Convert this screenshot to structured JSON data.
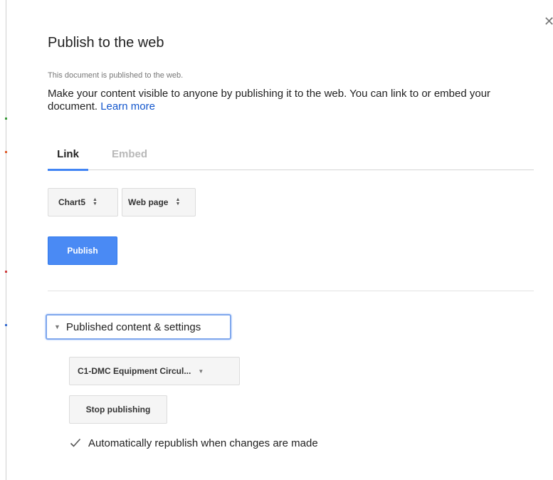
{
  "dialog": {
    "title": "Publish to the web",
    "status_note": "This document is published to the web.",
    "description": "Make your content visible to anyone by publishing it to the web. You can link to or embed your document.",
    "learn_more": "Learn more"
  },
  "tabs": [
    {
      "label": "Link",
      "selected": true
    },
    {
      "label": "Embed",
      "selected": false
    }
  ],
  "selectors": {
    "sheet": "Chart5",
    "format": "Web page"
  },
  "publish_label": "Publish",
  "settings": {
    "toggle_label": "Published content & settings",
    "expanded": true,
    "document_select": "C1-DMC Equipment Circul...",
    "stop_label": "Stop publishing",
    "auto_republish_label": "Automatically republish when changes are made",
    "auto_republish_checked": true
  },
  "icons": {
    "close": "close-icon",
    "updown": "updown-arrows-icon",
    "caret": "caret-down-icon",
    "dropdown": "dropdown-arrow-icon",
    "check": "check-icon"
  },
  "colors": {
    "accent": "#4285f4",
    "publish_button": "#4a8af4",
    "link": "#1155cc",
    "focus_ring": "#7fa7ed"
  }
}
